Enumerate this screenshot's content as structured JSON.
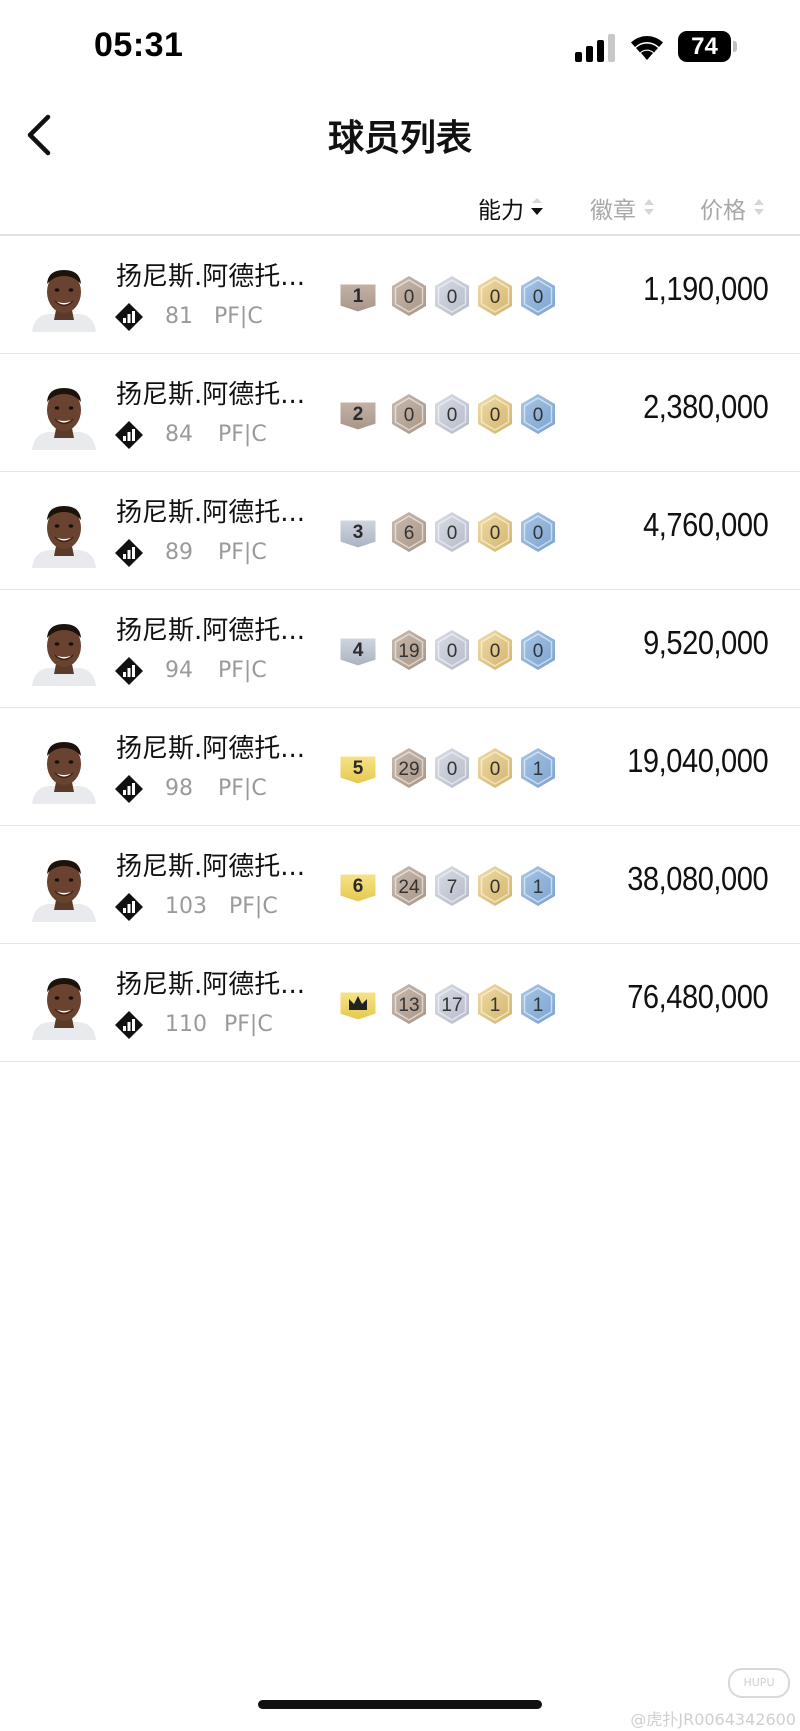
{
  "status_bar": {
    "time": "05:31",
    "battery_level": "74",
    "icons": [
      "signal-icon",
      "wifi-icon",
      "battery-icon"
    ]
  },
  "header": {
    "title": "球员列表",
    "back_icon": "chevron-left-icon"
  },
  "sort_options": [
    {
      "label": "能力",
      "active": true
    },
    {
      "label": "徽章",
      "active": false
    },
    {
      "label": "价格",
      "active": false
    }
  ],
  "colors": {
    "grade_brown": "#b8a79a",
    "grade_silver": "#c5ccd6",
    "grade_gold": "#f3de7a",
    "hex_bronze": "#b9aca0",
    "hex_silver": "#c9ced9",
    "hex_gold": "#e2c98a",
    "hex_blue": "#8fb2d6",
    "price_text": "#111111",
    "muted_text": "#9a9a9a"
  },
  "players": [
    {
      "name": "扬尼斯.阿德托...",
      "rating": "81",
      "position": "PF|C",
      "grade": "1",
      "grade_icon": "number",
      "badges": [
        "0",
        "0",
        "0",
        "0"
      ],
      "price": "1,190,000"
    },
    {
      "name": "扬尼斯.阿德托...",
      "rating": "84",
      "position": "PF|C",
      "grade": "2",
      "grade_icon": "number",
      "badges": [
        "0",
        "0",
        "0",
        "0"
      ],
      "price": "2,380,000"
    },
    {
      "name": "扬尼斯.阿德托...",
      "rating": "89",
      "position": "PF|C",
      "grade": "3",
      "grade_icon": "number",
      "badges": [
        "6",
        "0",
        "0",
        "0"
      ],
      "price": "4,760,000"
    },
    {
      "name": "扬尼斯.阿德托...",
      "rating": "94",
      "position": "PF|C",
      "grade": "4",
      "grade_icon": "number",
      "badges": [
        "19",
        "0",
        "0",
        "0"
      ],
      "price": "9,520,000"
    },
    {
      "name": "扬尼斯.阿德托...",
      "rating": "98",
      "position": "PF|C",
      "grade": "5",
      "grade_icon": "number",
      "badges": [
        "29",
        "0",
        "0",
        "1"
      ],
      "price": "19,040,000"
    },
    {
      "name": "扬尼斯.阿德托...",
      "rating": "103",
      "position": "PF|C",
      "grade": "6",
      "grade_icon": "number",
      "badges": [
        "24",
        "7",
        "0",
        "1"
      ],
      "price": "38,080,000"
    },
    {
      "name": "扬尼斯.阿德托...",
      "rating": "110",
      "position": "PF|C",
      "grade": "",
      "grade_icon": "crown-icon",
      "badges": [
        "13",
        "17",
        "1",
        "1"
      ],
      "price": "76,480,000"
    }
  ],
  "watermark": {
    "logo": "HUPU",
    "text": "@虎扑JR0064342600"
  }
}
